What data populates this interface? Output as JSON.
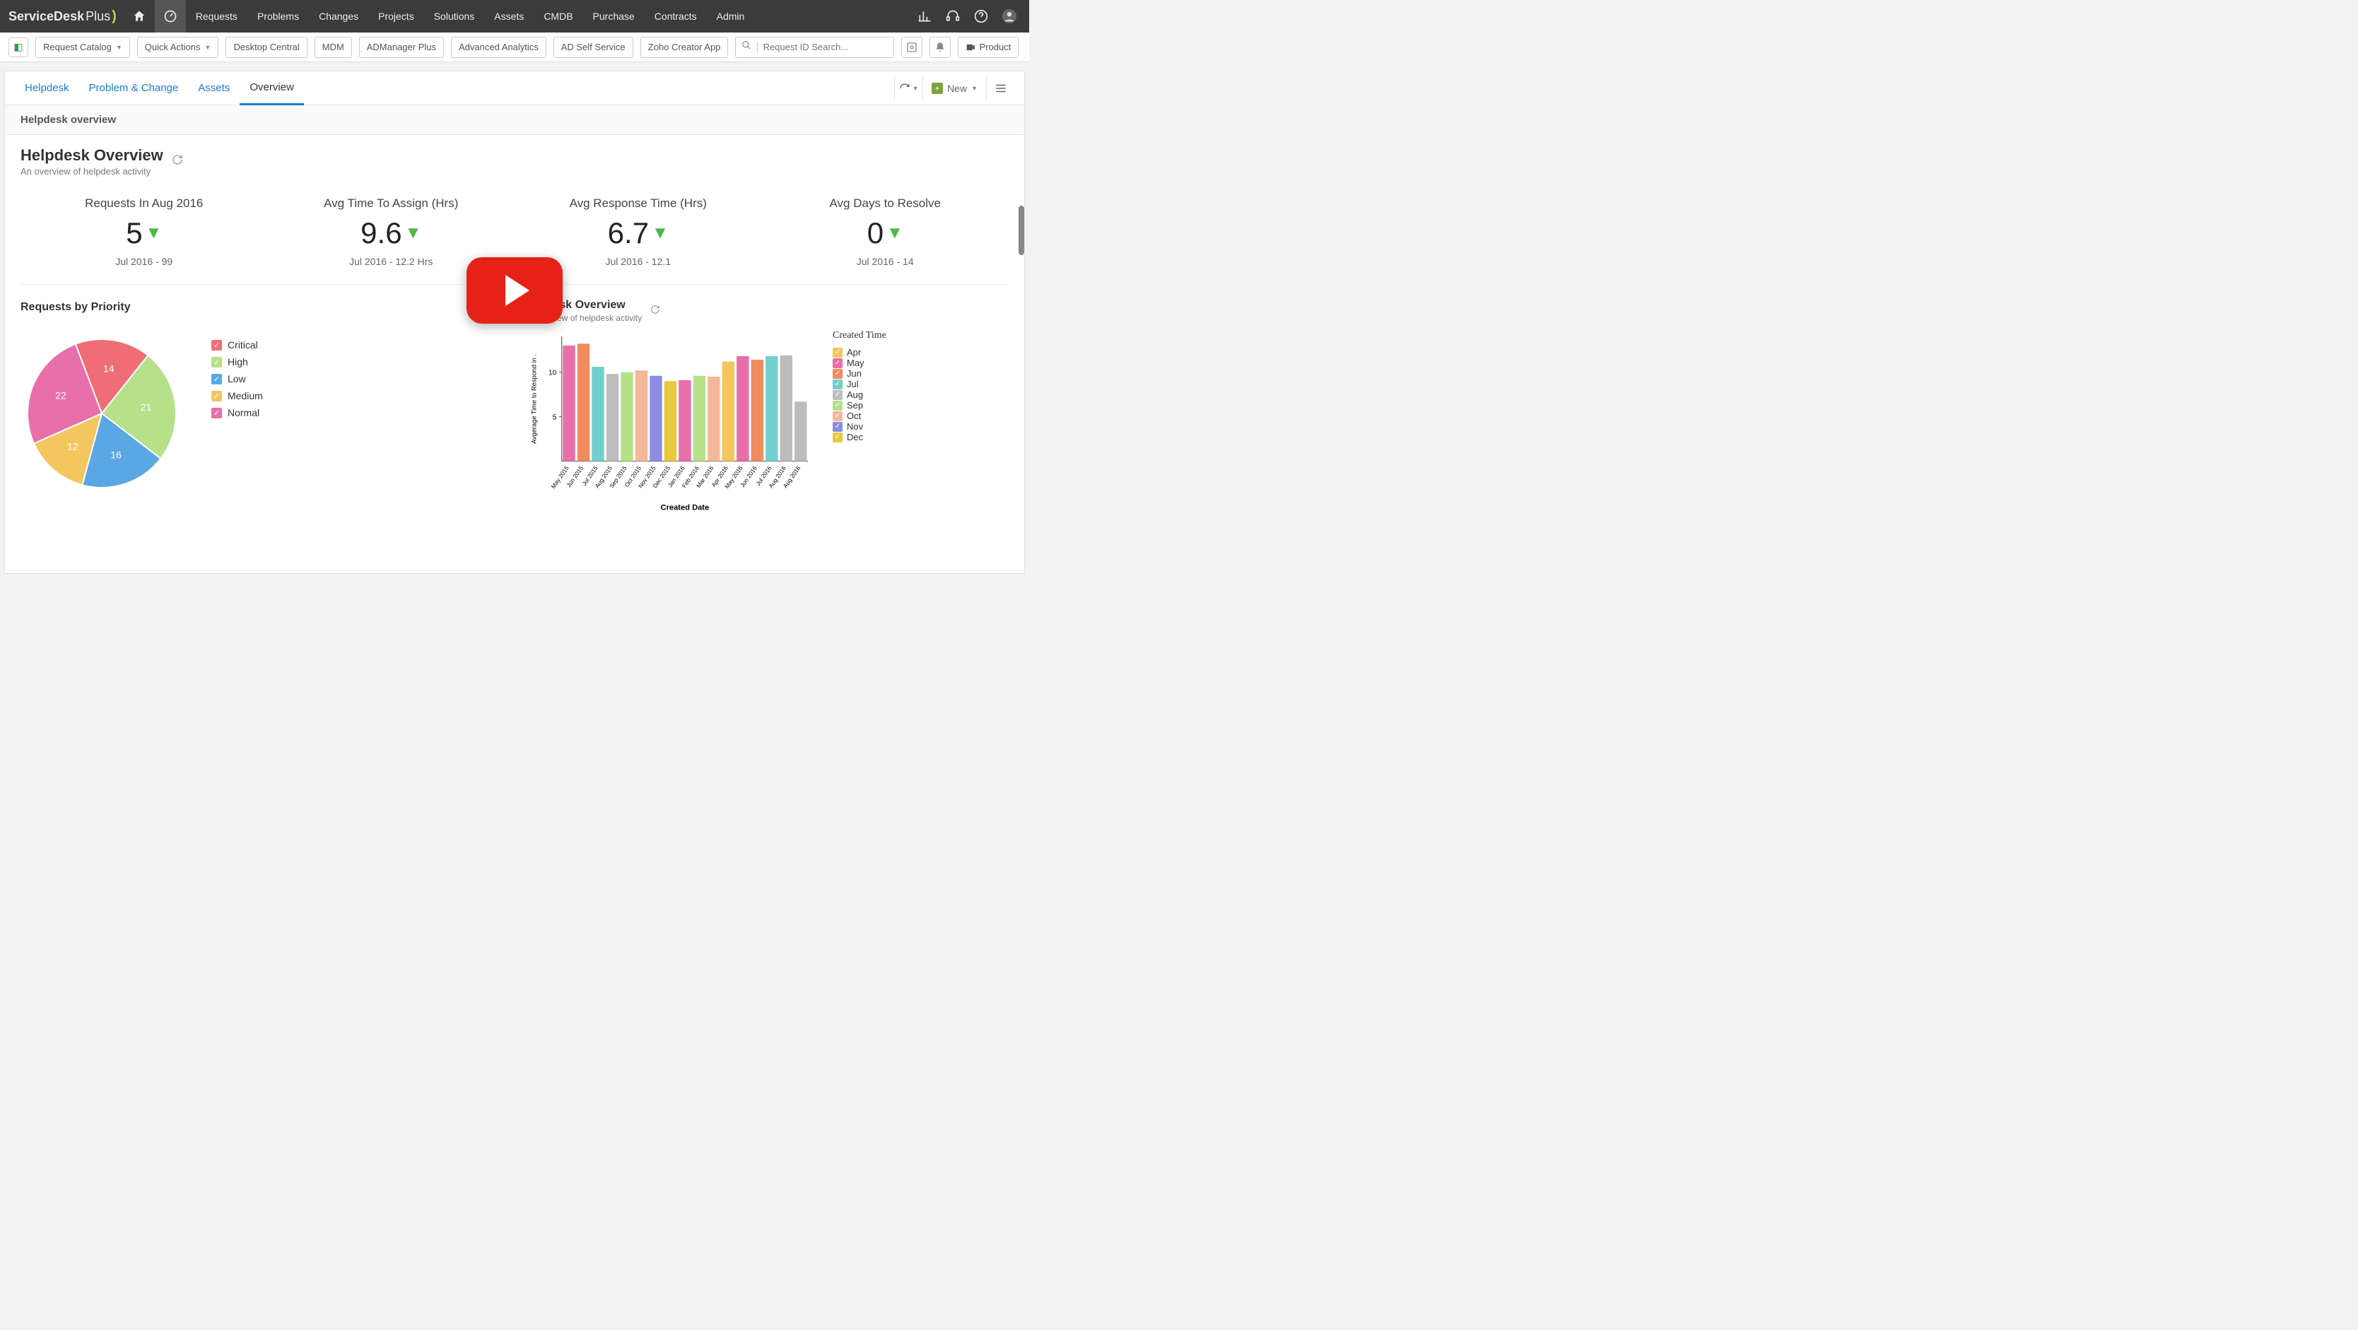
{
  "brand": {
    "strong": "ServiceDesk",
    "light": "Plus"
  },
  "topnav": {
    "items": [
      "Requests",
      "Problems",
      "Changes",
      "Projects",
      "Solutions",
      "Assets",
      "CMDB",
      "Purchase",
      "Contracts",
      "Admin"
    ]
  },
  "toolbar": {
    "request_catalog": "Request Catalog",
    "quick_actions": "Quick Actions",
    "links": [
      "Desktop Central",
      "MDM",
      "ADManager Plus",
      "Advanced Analytics",
      "AD Self Service",
      "Zoho Creator App"
    ],
    "search_placeholder": "Request ID Search...",
    "product_btn": "Product"
  },
  "tabs": {
    "items": [
      "Helpdesk",
      "Problem & Change",
      "Assets",
      "Overview"
    ],
    "active": "Overview",
    "new_label": "New"
  },
  "section_bar": "Helpdesk overview",
  "overview": {
    "title": "Helpdesk Overview",
    "subtitle": "An overview of helpdesk activity",
    "kpis": [
      {
        "label": "Requests In Aug 2016",
        "value": "5",
        "footer": "Jul 2016 - 99"
      },
      {
        "label": "Avg Time To Assign (Hrs)",
        "value": "9.6",
        "footer": "Jul 2016 - 12.2 Hrs"
      },
      {
        "label": "Avg Response Time (Hrs)",
        "value": "6.7",
        "footer": "Jul 2016 - 12.1"
      },
      {
        "label": "Avg Days to Resolve",
        "value": "0",
        "footer": "Jul 2016 - 14"
      }
    ]
  },
  "pie_panel": {
    "title": "Requests by Priority",
    "legend": [
      {
        "label": "Critical",
        "color": "#ef6d74"
      },
      {
        "label": "High",
        "color": "#b6e08a"
      },
      {
        "label": "Low",
        "color": "#5aa7e3"
      },
      {
        "label": "Medium",
        "color": "#f3c75e"
      },
      {
        "label": "Normal",
        "color": "#e86fa9"
      }
    ]
  },
  "bar_panel": {
    "title": "Helpdesk Overview",
    "subtitle": "An overview of helpdesk activity",
    "legend_title": "Created Time",
    "legend": [
      {
        "label": "Apr",
        "color": "#f3c75e"
      },
      {
        "label": "May",
        "color": "#e86fa9"
      },
      {
        "label": "Jun",
        "color": "#f08a5f"
      },
      {
        "label": "Jul",
        "color": "#6fd0cf"
      },
      {
        "label": "Aug",
        "color": "#bdbdbd"
      },
      {
        "label": "Sep",
        "color": "#b6e08a"
      },
      {
        "label": "Oct",
        "color": "#f4b79a"
      },
      {
        "label": "Nov",
        "color": "#8a8de0"
      },
      {
        "label": "Dec",
        "color": "#e8c93d"
      }
    ],
    "ylabel": "Avgerage Time to Respond in .",
    "xlabel": "Created Date"
  },
  "chart_data": [
    {
      "type": "pie",
      "title": "Requests by Priority",
      "series": [
        {
          "name": "Critical",
          "value": 14,
          "color": "#ef6d74"
        },
        {
          "name": "High",
          "value": 21,
          "color": "#b6e08a"
        },
        {
          "name": "Low",
          "value": 16,
          "color": "#5aa7e3"
        },
        {
          "name": "Medium",
          "value": 12,
          "color": "#f3c75e"
        },
        {
          "name": "Normal",
          "value": 22,
          "color": "#e86fa9"
        }
      ]
    },
    {
      "type": "bar",
      "title": "Helpdesk Overview",
      "xlabel": "Created Date",
      "ylabel": "Avgerage Time to Respond in .",
      "ylim": [
        0,
        14
      ],
      "yticks": [
        5,
        10
      ],
      "categories": [
        "May 2015",
        "Jun 2015",
        "Jul 2015",
        "Aug 2015",
        "Sep 2015",
        "Oct 2015",
        "Nov 2015",
        "Dec 2015",
        "Jan 2016",
        "Feb 2016",
        "Mar 2016",
        "Apr 2016",
        "May 2016",
        "Jun 2016",
        "Jul 2016",
        "Aug 2016"
      ],
      "values": [
        13.0,
        13.2,
        10.6,
        9.8,
        10.0,
        10.2,
        9.6,
        9.0,
        9.1,
        9.6,
        9.5,
        11.2,
        11.8,
        11.4,
        11.8,
        11.9
      ],
      "colors": [
        "#e86fa9",
        "#f08a5f",
        "#6fd0cf",
        "#bdbdbd",
        "#b6e08a",
        "#f4b79a",
        "#8a8de0",
        "#e8c93d",
        "#e86fa9",
        "#b6e08a",
        "#f4b79a",
        "#f3c75e",
        "#e86fa9",
        "#f08a5f",
        "#6fd0cf",
        "#bdbdbd"
      ],
      "extra_bar": {
        "after_index": 15,
        "value": 6.7,
        "color": "#bdbdbd"
      }
    }
  ]
}
